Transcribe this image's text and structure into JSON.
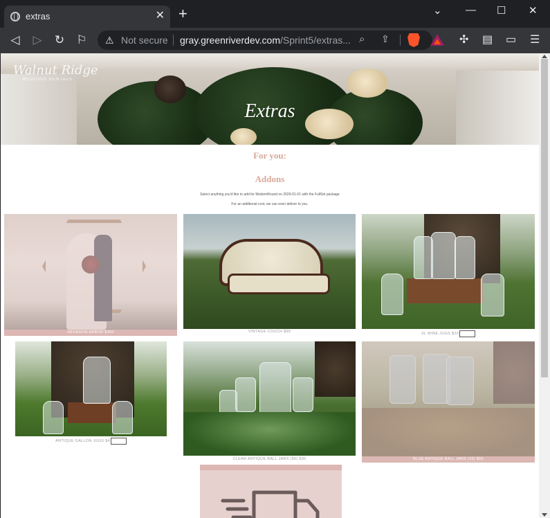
{
  "browser": {
    "tab_title": "extras",
    "security_label": "Not secure",
    "url_host": "gray.greenriverdev.com",
    "url_path": "/Sprint5/extras..."
  },
  "hero": {
    "logo_text": "Walnut Ridge",
    "logo_subtext": "WEDDING RENTALS",
    "title": "Extras"
  },
  "intro": {
    "for_you": "For you:",
    "heading": "Addons",
    "line1": "Select anything you'd like to add for ModernRound on 2029-01-01 with the FullSet package",
    "line2": "For an additional cost, we can even deliver to you."
  },
  "items": [
    {
      "label": "HEXAGON ARBOR $350",
      "selected": true
    },
    {
      "label": "VINTAGE COUCH $99",
      "selected": false
    },
    {
      "label": "XL WINE JUGS $20",
      "selected": false,
      "has_qty": true
    },
    {
      "label": "ANTIQUE GALLON JUGS $4",
      "selected": false,
      "has_qty": true
    },
    {
      "label": "CLEAR ANTIQUE BALL JARS (50) $30",
      "selected": false
    },
    {
      "label": "BLUE ANTIQUE BALL JARS (25) $50",
      "selected": true
    }
  ],
  "colors": {
    "accent": "#d7a89a",
    "selected_band": "#dcb7b3",
    "delivery_bg": "#e6d1cf"
  }
}
